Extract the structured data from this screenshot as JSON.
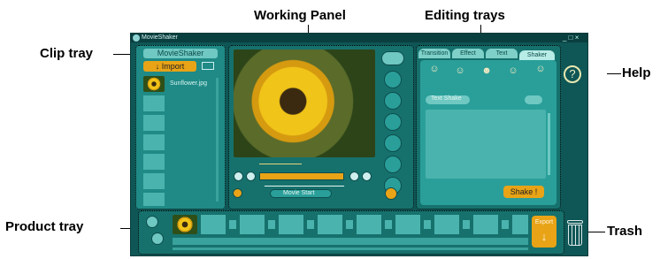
{
  "callouts": {
    "working_panel": "Working Panel",
    "editing_trays": "Editing trays",
    "clip_tray": "Clip tray",
    "help": "Help",
    "product_tray": "Product tray",
    "trash": "Trash"
  },
  "window": {
    "title": "MovieShaker",
    "controls": "_ □ ×"
  },
  "clip_tray": {
    "header": "MovieShaker",
    "import_label": "↓ Import",
    "clips": [
      {
        "name": "Sunflower.jpg"
      }
    ]
  },
  "working_panel": {
    "movie_start_label": "Movie Start",
    "tool_icons": [
      "audio-icon",
      "window-icon",
      "rotate-icon"
    ]
  },
  "editing_trays": {
    "tabs": [
      "Transition",
      "Effect",
      "Text",
      "Shaker"
    ],
    "active_tab": "Shaker",
    "text_shake_label": "Text Shake",
    "shake_button": "Shake !"
  },
  "product_tray": {
    "export_label": "Export",
    "export_arrow": "↓"
  },
  "colors": {
    "app_bg": "#0f5656",
    "panel_bg": "#1f8a86",
    "accent_orange": "#e8a316",
    "cell": "#4bb3ad"
  }
}
